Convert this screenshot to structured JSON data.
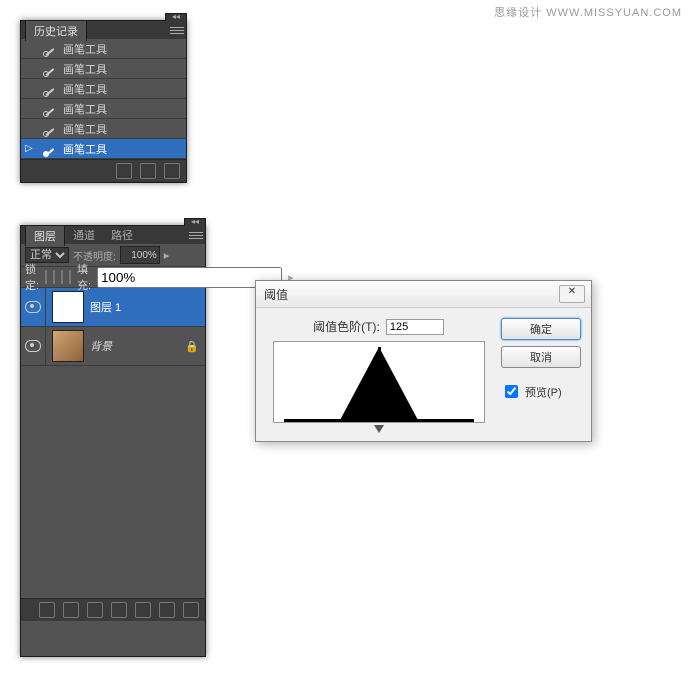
{
  "watermark": "思缘设计 WWW.MISSYUAN.COM",
  "history": {
    "title": "历史记录",
    "items": [
      {
        "label": "画笔工具",
        "selected": false,
        "marker": ""
      },
      {
        "label": "画笔工具",
        "selected": false,
        "marker": ""
      },
      {
        "label": "画笔工具",
        "selected": false,
        "marker": ""
      },
      {
        "label": "画笔工具",
        "selected": false,
        "marker": ""
      },
      {
        "label": "画笔工具",
        "selected": false,
        "marker": ""
      },
      {
        "label": "画笔工具",
        "selected": true,
        "marker": "▷"
      }
    ]
  },
  "layers": {
    "tabs": [
      "图层",
      "通道",
      "路径"
    ],
    "blend_mode": "正常",
    "opacity_label": "不透明度:",
    "opacity_value": "100%",
    "lock_label": "锁定:",
    "fill_label": "填充:",
    "fill_value": "100%",
    "items": [
      {
        "name": "图层 1",
        "selected": true,
        "italic": false,
        "bg": false,
        "locked": false
      },
      {
        "name": "背景",
        "selected": false,
        "italic": true,
        "bg": true,
        "locked": true
      }
    ]
  },
  "dialog": {
    "title": "阈值",
    "level_label": "阈值色阶(T):",
    "level_value": "125",
    "ok": "确定",
    "cancel": "取消",
    "preview": "预览(P)",
    "close": "✕"
  },
  "chart_data": {
    "type": "area",
    "title": "阈值",
    "xlabel": "",
    "ylabel": "",
    "x": [
      0,
      255
    ],
    "threshold": 125,
    "note": "Single sharp histogram peak near midtones (≈125) with very low values elsewhere"
  },
  "icons": {
    "menu": "≡",
    "trash": "🗑",
    "new": "▣"
  }
}
